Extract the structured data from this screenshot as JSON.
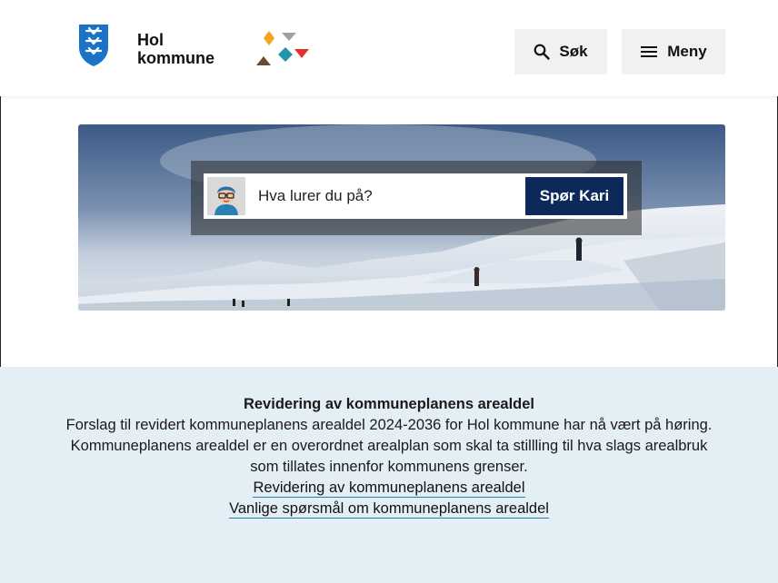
{
  "header": {
    "brand_line1": "Hol",
    "brand_line2": "kommune",
    "search_label": "Søk",
    "menu_label": "Meny"
  },
  "hero": {
    "chat_placeholder": "Hva lurer du på?",
    "chat_button": "Spør Kari"
  },
  "info": {
    "title": "Revidering av kommuneplanens arealdel",
    "paragraph_lines": [
      "Forslag til revidert kommuneplanens arealdel 2024-2036 for Hol kommune har nå vært på høring.",
      "Kommuneplanens arealdel er en overordnet arealplan som skal ta stillling til hva slags arealbruk",
      "som tillates innenfor kommunens grenser."
    ],
    "links": [
      "Revidering av kommuneplanens arealdel",
      "Vanlige spørsmål om kommuneplanens arealdel"
    ]
  },
  "colors": {
    "crest_blue": "#1a73c7",
    "button_navy": "#0b2a5b",
    "info_bg": "#e4eff5",
    "link_underline": "#2b7aa8",
    "shape_orange": "#f2a31f",
    "shape_grey": "#9aa3aa",
    "shape_red": "#e0342b",
    "shape_teal": "#1f97a8",
    "shape_brown": "#6b4a2f"
  },
  "icons": {
    "crest": "municipality-crest-icon",
    "logo": "colored-shapes-logo-icon",
    "search": "search-icon",
    "menu": "hamburger-menu-icon",
    "avatar": "kari-avatar-icon"
  }
}
